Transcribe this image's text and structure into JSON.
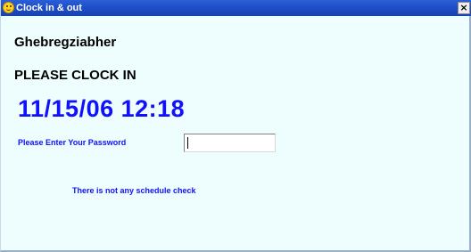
{
  "window": {
    "title": "Clock in & out",
    "close_glyph": "×",
    "icon": "smiley-face-icon",
    "titlebar_color": "#1e4fc8",
    "background_color": "#eefdfd"
  },
  "employee": {
    "name": "Ghebregziabher"
  },
  "prompt": {
    "text": "PLEASE CLOCK IN"
  },
  "clock": {
    "datetime": "11/15/06 12:18",
    "color": "#1010ff"
  },
  "password": {
    "label": "Please Enter Your Password",
    "value": ""
  },
  "schedule": {
    "message": "There is not any schedule check"
  }
}
